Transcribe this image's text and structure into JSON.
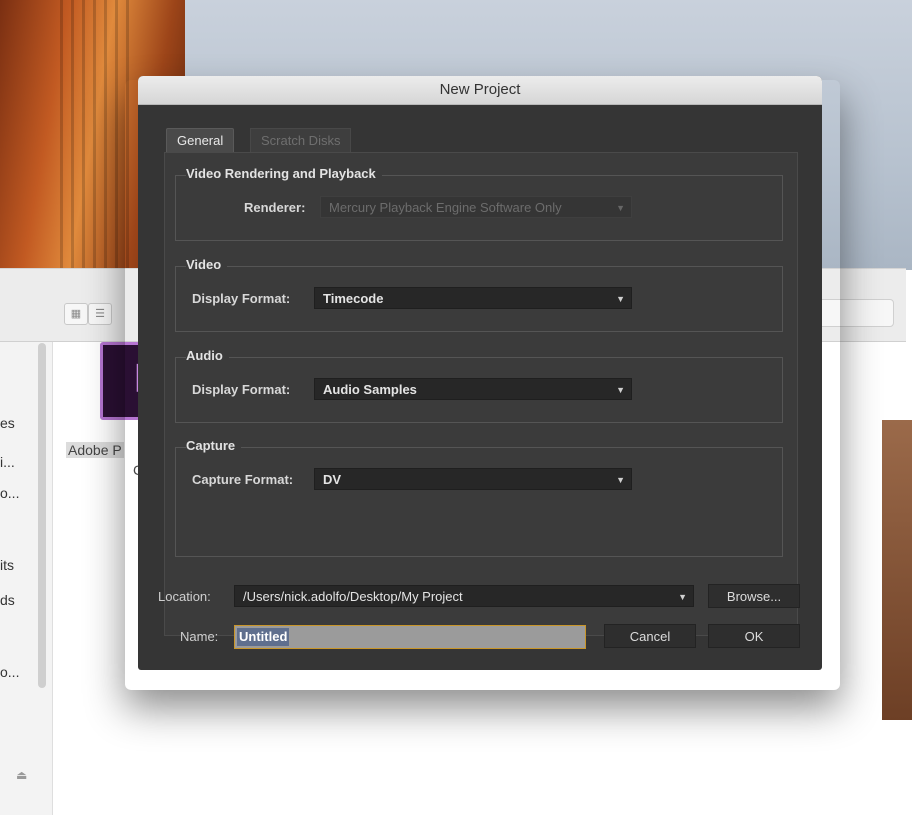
{
  "dialog": {
    "title": "New Project",
    "tabs": [
      {
        "label": "General",
        "active": true
      },
      {
        "label": "Scratch Disks",
        "active": false
      }
    ],
    "video_rendering": {
      "group_title": "Video Rendering and Playback",
      "renderer_label": "Renderer:",
      "renderer_value": "Mercury Playback Engine Software Only",
      "renderer_enabled": false
    },
    "video": {
      "group_title": "Video",
      "display_format_label": "Display Format:",
      "display_format_value": "Timecode"
    },
    "audio": {
      "group_title": "Audio",
      "display_format_label": "Display Format:",
      "display_format_value": "Audio Samples"
    },
    "capture": {
      "group_title": "Capture",
      "capture_format_label": "Capture Format:",
      "capture_format_value": "DV"
    },
    "location": {
      "label": "Location:",
      "value": "/Users/nick.adolfo/Desktop/My Project",
      "browse_label": "Browse..."
    },
    "name": {
      "label": "Name:",
      "value": "Untitled"
    },
    "buttons": {
      "cancel": "Cancel",
      "ok": "OK"
    }
  },
  "finder": {
    "sidebar_fragments": [
      "es",
      "i...",
      "o...",
      "its",
      "ds",
      "o..."
    ],
    "app_label_line1": "Adobe P",
    "app_label_line2": "C",
    "app_icon_glyph": "P"
  },
  "icons": {
    "dropdown_arrow": "chevron-down-icon",
    "grid_view": "grid-view-icon",
    "list_view": "list-view-icon",
    "eject": "eject-icon"
  }
}
